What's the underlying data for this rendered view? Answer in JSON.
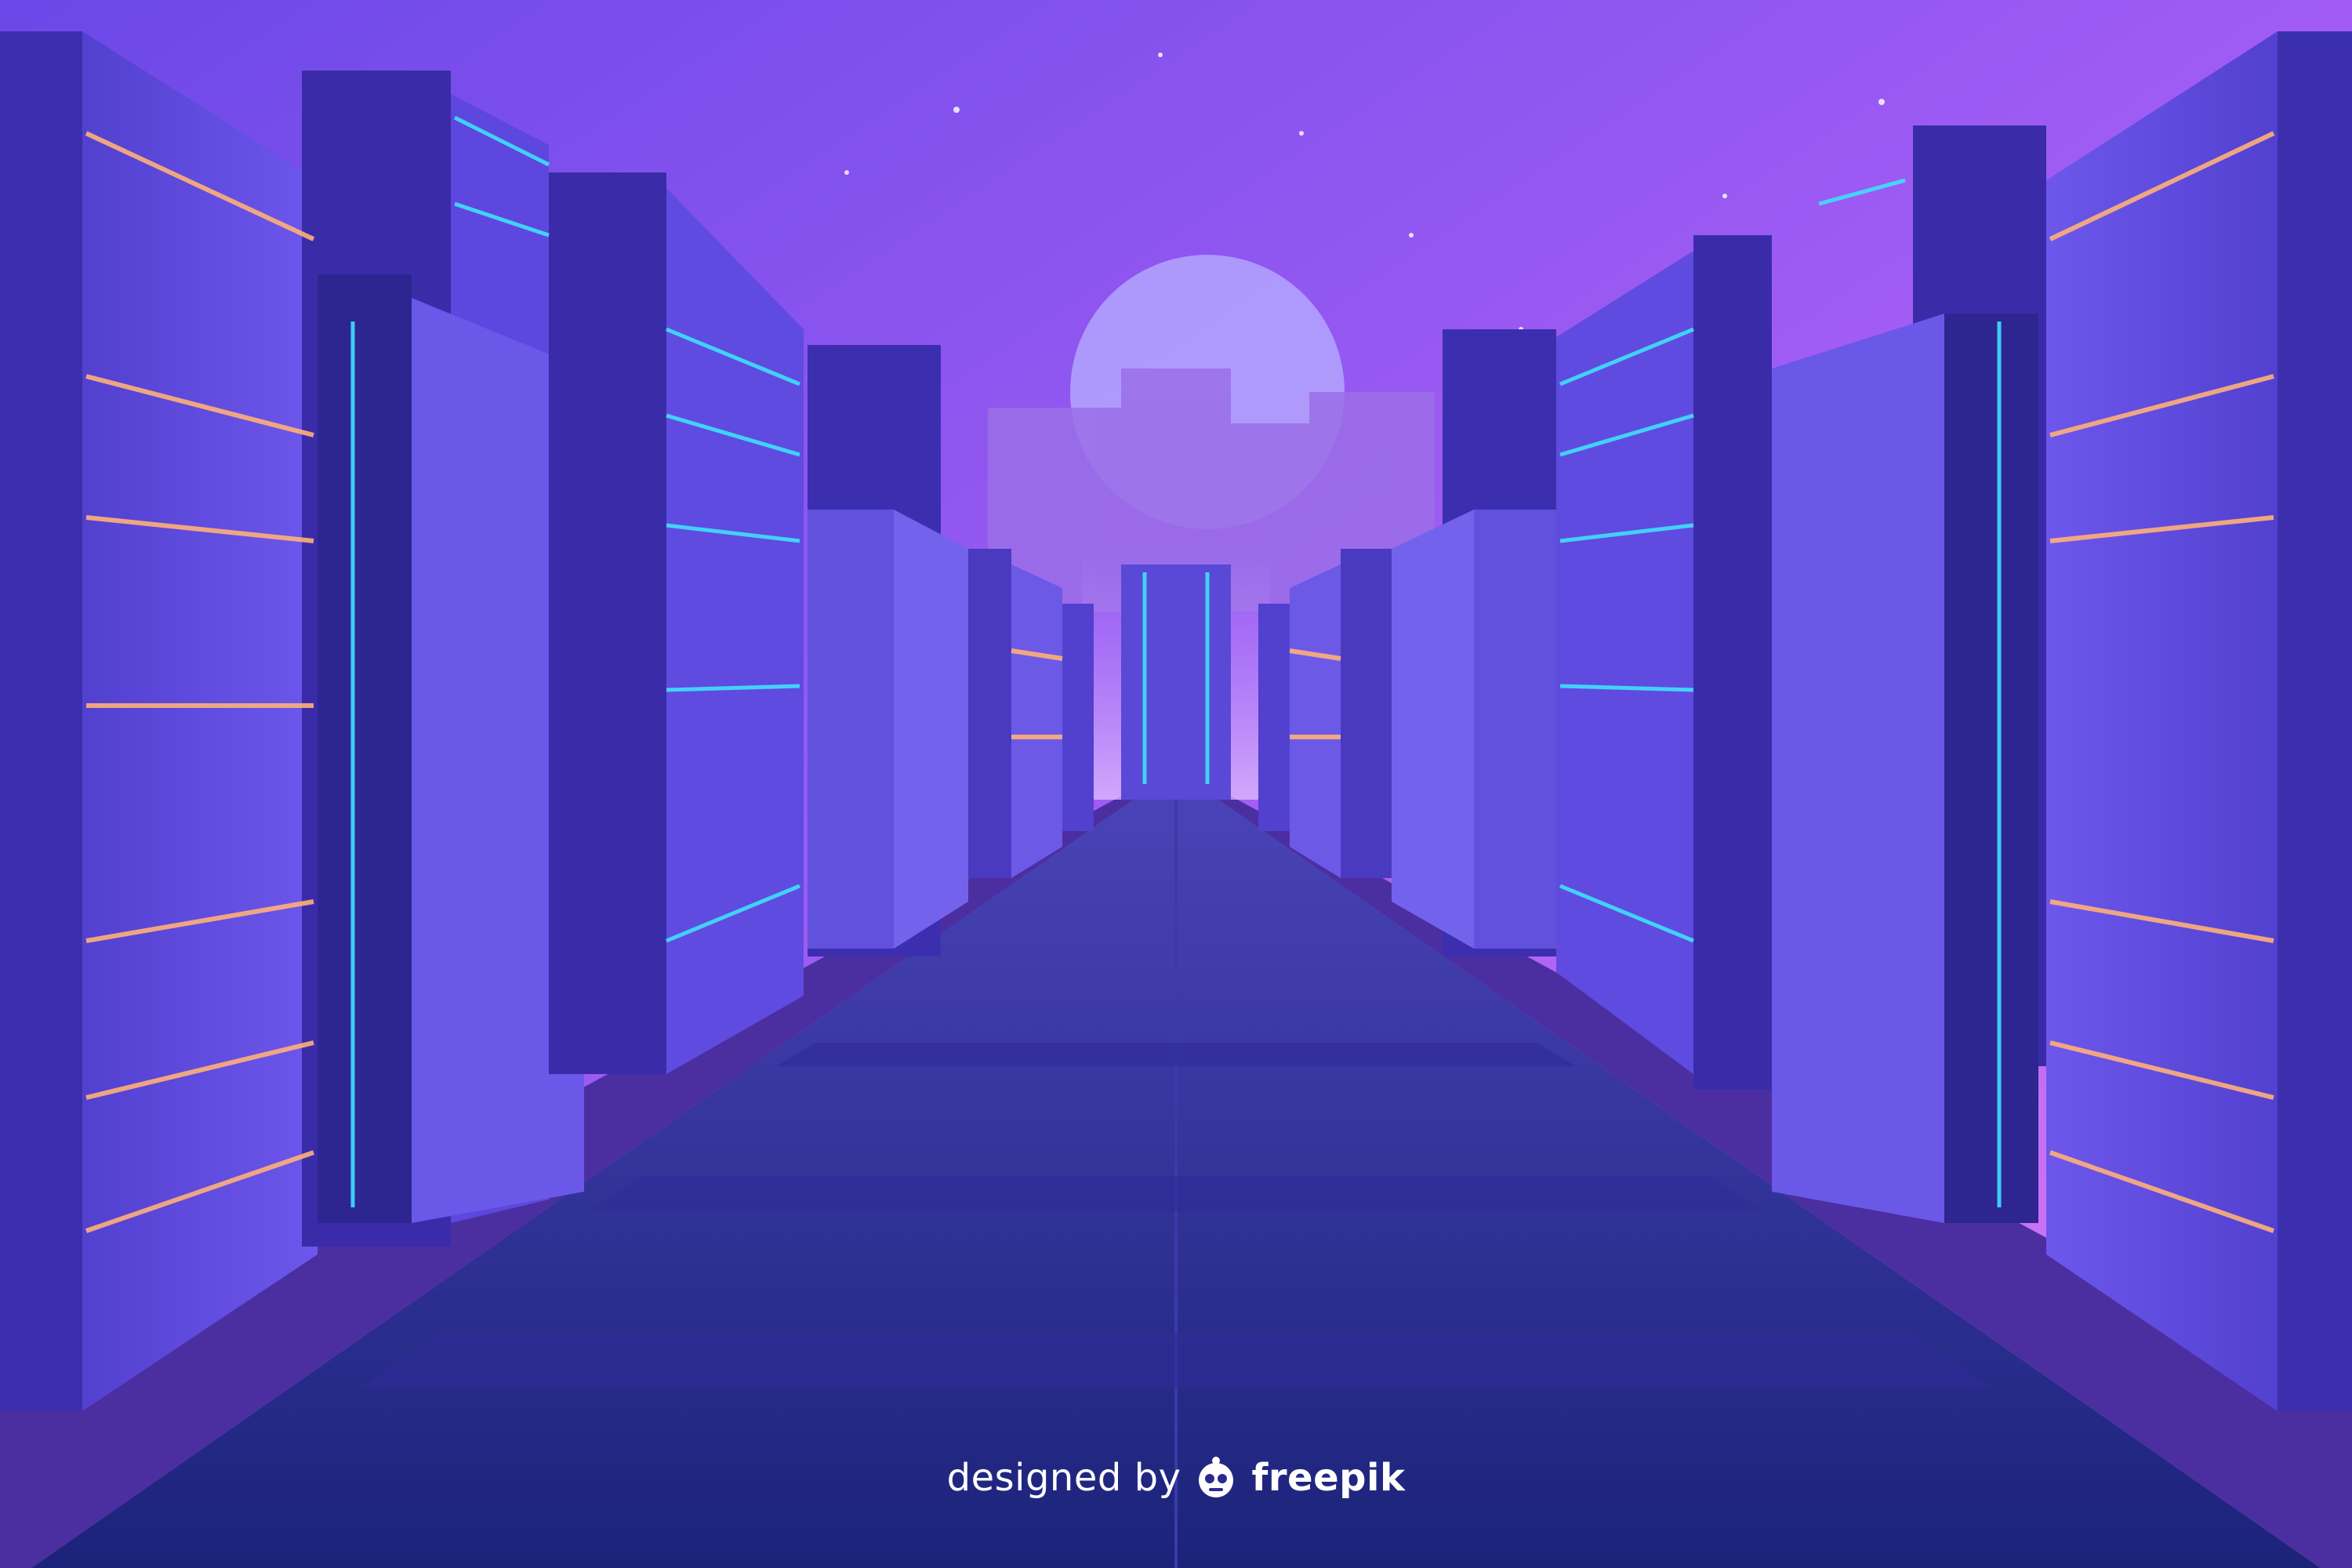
{
  "scene": {
    "description_colors": {
      "sky_top": "#8a4cf2",
      "sky_bottom": "#e27ef6",
      "moon": "#b7b0ff",
      "building_face": "#5f4ae0",
      "building_dark": "#3a2ca8",
      "road": "#24278f",
      "accent_cyan": "#3fe0ff",
      "accent_orange": "#ffb07a"
    }
  },
  "credit": {
    "designed_by": "designed by",
    "brand": "freepik",
    "mascot_icon": "freepik-mascot-icon"
  }
}
